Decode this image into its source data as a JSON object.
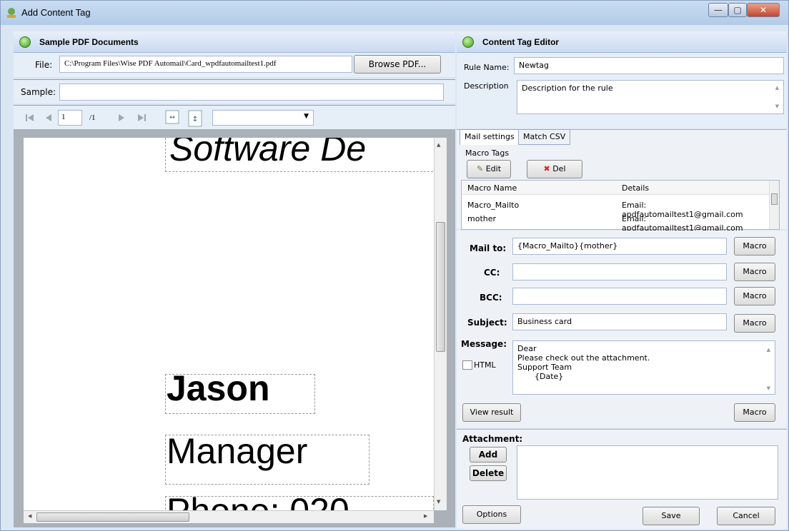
{
  "window": {
    "title": "Add Content Tag"
  },
  "left_panel": {
    "header": "Sample PDF Documents",
    "file_label": "File:",
    "file_value": "C:\\Program Files\\Wise PDF Automail\\Card_wpdfautomailtest1.pdf",
    "browse_label": "Browse PDF...",
    "sample_label": "Sample:",
    "sample_value": "",
    "page_number": "1",
    "page_total": "/1",
    "zoom_value": ""
  },
  "pdf_page": {
    "line1": "Software De",
    "line2": "Jason",
    "line3": "Manager",
    "line4": "Phone: 020"
  },
  "right_panel": {
    "header": "Content Tag Editor",
    "rule_name_label": "Rule Name:",
    "rule_name_value": "Newtag",
    "description_label": "Description",
    "description_value": "Description for the rule",
    "tabs": [
      "Mail settings",
      "Match CSV"
    ],
    "macro_tags_label": "Macro Tags",
    "edit_label": "Edit",
    "del_label": "Del",
    "macro_columns": [
      "Macro Name",
      "Details"
    ],
    "macro_rows": [
      {
        "name": "Macro_Mailto",
        "details": "Email: apdfautomailtest1@gmail.com"
      },
      {
        "name": "mother",
        "details": "Email: apdfautomailtest1@gmail.com"
      }
    ],
    "mail_to_label": "Mail to:",
    "mail_to_value": "{Macro_Mailto}{mother}",
    "cc_label": "CC:",
    "cc_value": "",
    "bcc_label": "BCC:",
    "bcc_value": "",
    "subject_label": "Subject:",
    "subject_value": "Business card",
    "message_label": "Message:",
    "message_lines": [
      "Dear",
      "Please check out the attachment.",
      "Support Team",
      "{Date}"
    ],
    "html_label": "HTML",
    "macro_label": "Macro",
    "view_result_label": "View result",
    "attachment_label": "Attachment:",
    "add_label": "Add",
    "delete_label": "Delete",
    "options_label": "Options",
    "save_label": "Save",
    "cancel_label": "Cancel"
  },
  "colors": {
    "accent": "#3a9c1c",
    "window": "#dbe6f3"
  }
}
